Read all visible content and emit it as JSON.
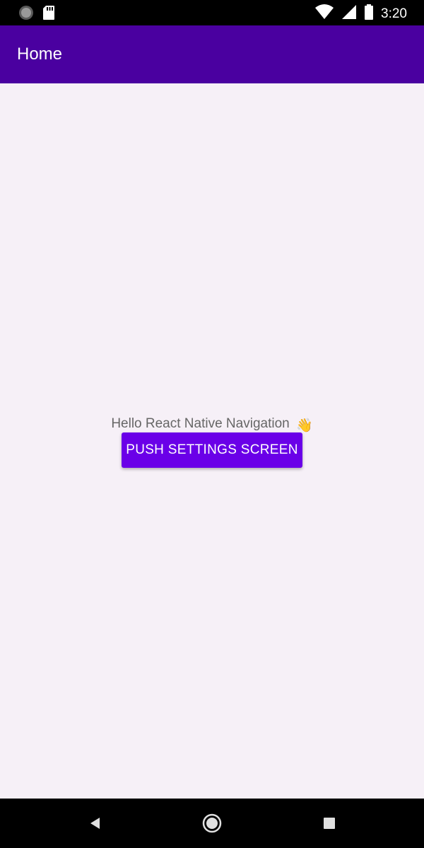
{
  "status_bar": {
    "time": "3:20",
    "icons": [
      "circle-status-icon",
      "sd-card-icon",
      "wifi-icon",
      "signal-icon",
      "battery-icon"
    ]
  },
  "app_bar": {
    "title": "Home",
    "background": "#4a00a0"
  },
  "main": {
    "greeting": "Hello React Native Navigation",
    "greeting_emoji": "👋",
    "push_button_label": "PUSH SETTINGS SCREEN",
    "button_color": "#6a00e8"
  },
  "nav_bar": {
    "icons": [
      "back-icon",
      "home-icon",
      "recents-icon"
    ]
  }
}
